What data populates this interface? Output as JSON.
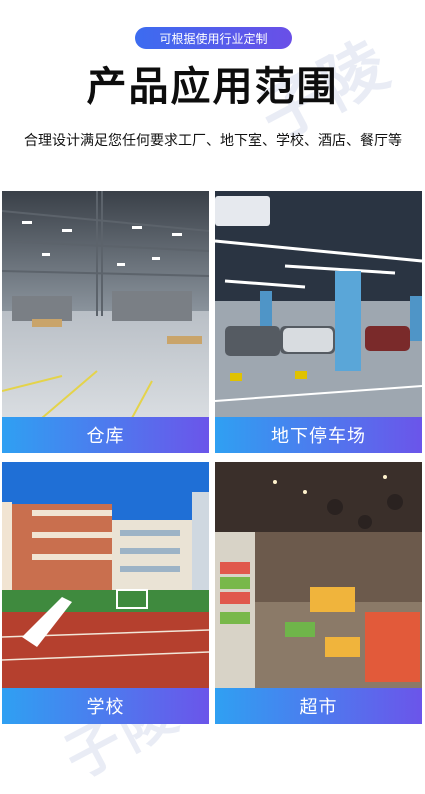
{
  "badge": "可根据使用行业定制",
  "title": "产品应用范围",
  "description": "合理设计满足您任何要求工厂、地下室、学校、酒店、餐厅等",
  "watermark": "子陵",
  "cards": [
    {
      "caption": "仓库",
      "scene": "warehouse"
    },
    {
      "caption": "地下停车场",
      "scene": "parking"
    },
    {
      "caption": "学校",
      "scene": "school"
    },
    {
      "caption": "超市",
      "scene": "supermarket"
    }
  ],
  "colors": {
    "caption_gradient": [
      "#2fa0f2",
      "#6b55ea"
    ],
    "badge_gradient": [
      "#3c6cf0",
      "#6a4fe7"
    ]
  }
}
